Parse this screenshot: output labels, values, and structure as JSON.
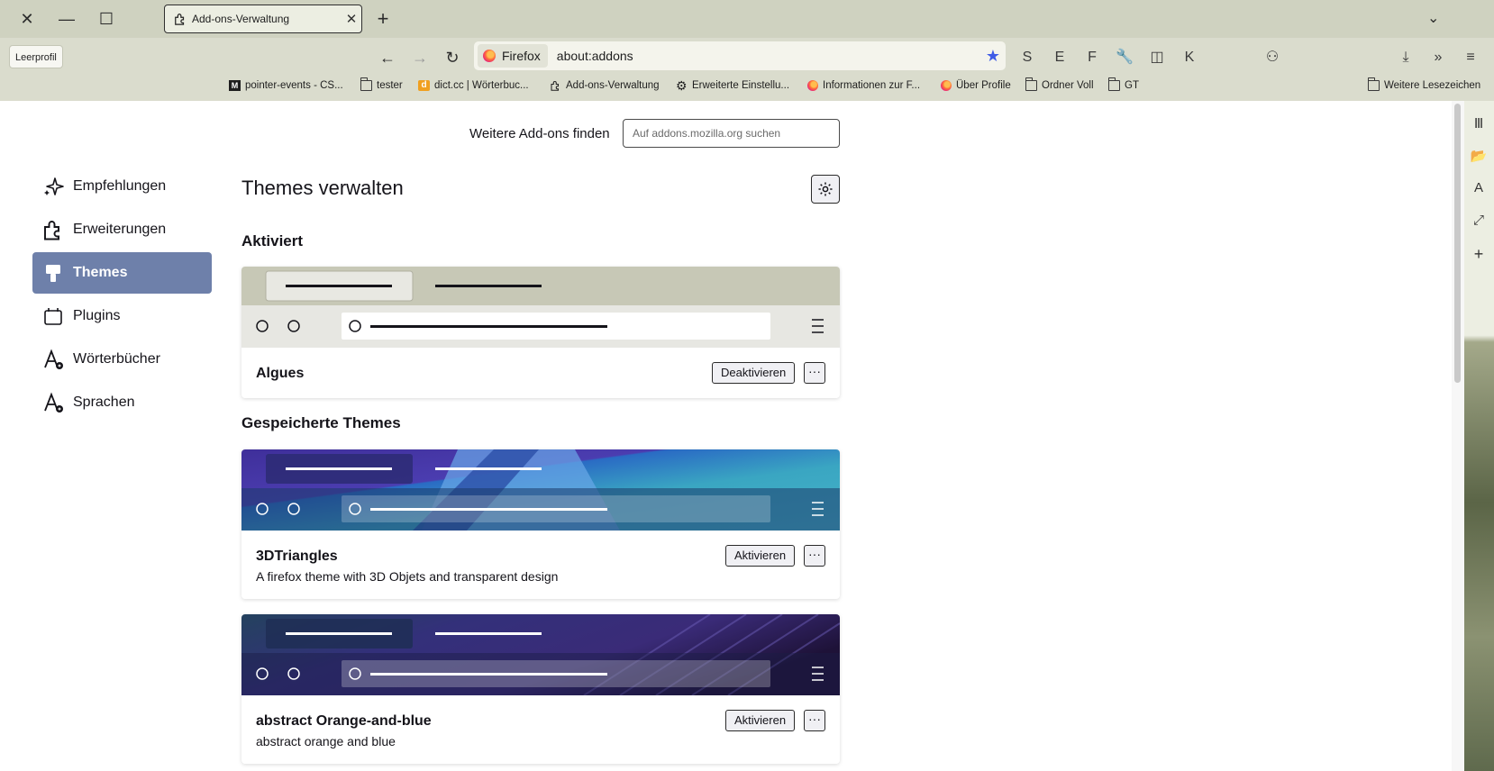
{
  "window": {
    "close_glyph": "✕",
    "minimize_glyph": "—",
    "maximize_glyph": "☐"
  },
  "tab": {
    "title": "Add-ons-Verwaltung",
    "close_glyph": "✕",
    "new_tab_glyph": "+",
    "list_all_glyph": "⌄"
  },
  "profile": {
    "label": "Leerprofil"
  },
  "nav": {
    "back": "←",
    "forward": "→",
    "reload": "↻"
  },
  "urlbar": {
    "identity": "Firefox",
    "url": "about:addons",
    "star": "★"
  },
  "toolbar": {
    "s": "S",
    "e": "E",
    "f": "F",
    "wrench": "🔧",
    "reader": "◫",
    "k": "K",
    "extensions": "⚇",
    "downloads": "⤓",
    "overflow": "»",
    "menu": "≡"
  },
  "bookmarks": {
    "items": [
      {
        "label": "pointer-events - CS..."
      },
      {
        "label": "tester"
      },
      {
        "label": "dict.cc | Wörterbuc..."
      },
      {
        "label": "Add-ons-Verwaltung"
      },
      {
        "label": "Erweiterte Einstellu..."
      },
      {
        "label": "Informationen zur F..."
      },
      {
        "label": "Über Profile"
      },
      {
        "label": "Ordner Voll"
      },
      {
        "label": "GT"
      }
    ],
    "other": "Weitere Lesezeichen"
  },
  "sidebar_icons": {
    "library": "Ⅲ",
    "folder": "📂",
    "font": "A",
    "resize": "⤢",
    "add": "+"
  },
  "find": {
    "label": "Weitere Add-ons finden",
    "placeholder": "Auf addons.mozilla.org suchen"
  },
  "categories": [
    {
      "label": "Empfehlungen"
    },
    {
      "label": "Erweiterungen"
    },
    {
      "label": "Themes"
    },
    {
      "label": "Plugins"
    },
    {
      "label": "Wörterbücher"
    },
    {
      "label": "Sprachen"
    }
  ],
  "page": {
    "title": "Themes verwalten"
  },
  "sections": {
    "active": "Aktiviert",
    "saved": "Gespeicherte Themes"
  },
  "themes": {
    "active": {
      "name": "Algues",
      "button": "Deaktivieren",
      "more": "···"
    },
    "saved": [
      {
        "name": "3DTriangles",
        "description": "A firefox theme with 3D Objets and transparent design",
        "button": "Aktivieren",
        "more": "···"
      },
      {
        "name": "abstract Orange-and-blue",
        "description": "abstract orange and blue",
        "button": "Aktivieren",
        "more": "···"
      }
    ]
  },
  "colors": {
    "selected_category": "#6e80aa",
    "bookmark_star": "#3f5ce6",
    "chrome": "#dadccd"
  }
}
